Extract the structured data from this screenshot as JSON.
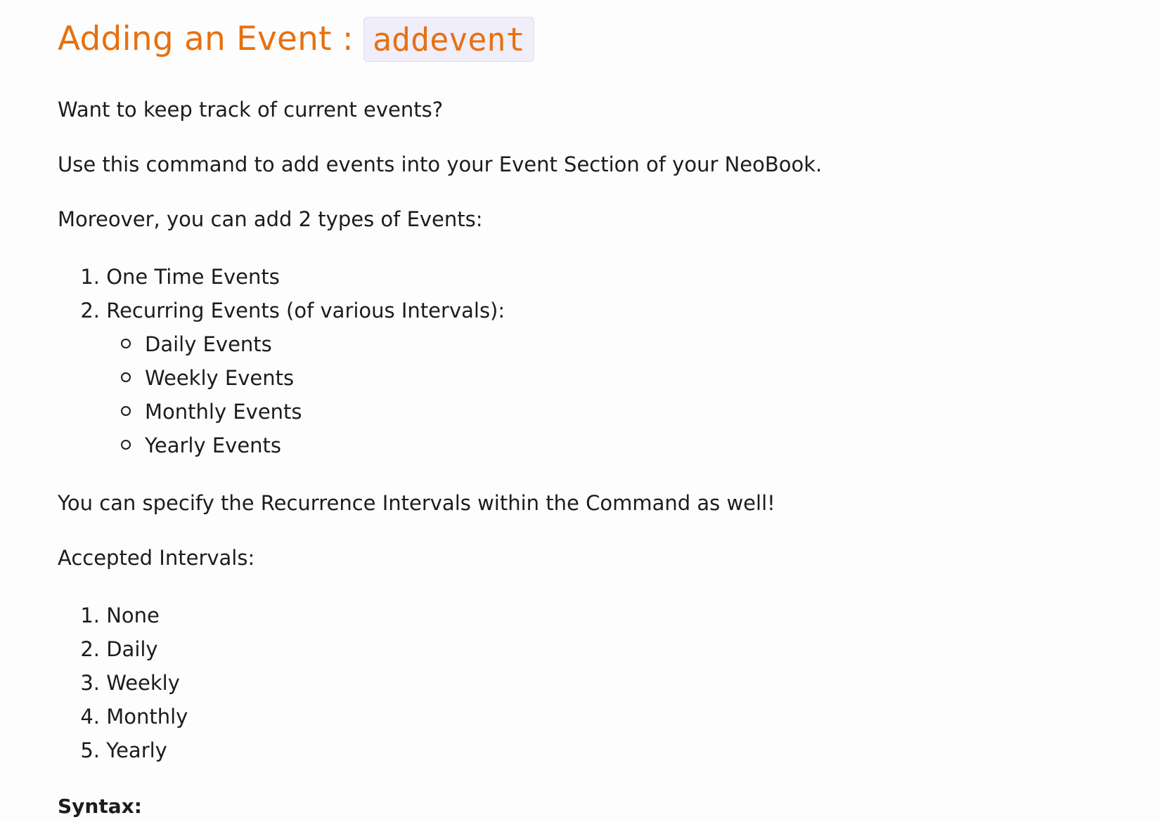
{
  "heading": {
    "title": "Adding an Event :",
    "command": "addevent"
  },
  "intro": {
    "line1": "Want to keep track of current events?",
    "line2": "Use this command to add events into your Event Section of your NeoBook.",
    "line3": "Moreover, you can add 2 types of Events:"
  },
  "event_types": [
    {
      "number": "1.",
      "label": "One Time Events"
    },
    {
      "number": "2.",
      "label": "Recurring Events (of various Intervals):"
    }
  ],
  "recurring_types": [
    "Daily Events",
    "Weekly Events",
    "Monthly Events",
    "Yearly Events"
  ],
  "recurrence_note": "You can specify the Recurrence Intervals within the Command as well!",
  "intervals_heading": "Accepted Intervals:",
  "intervals": [
    {
      "number": "1.",
      "label": "None"
    },
    {
      "number": "2.",
      "label": "Daily"
    },
    {
      "number": "3.",
      "label": "Weekly"
    },
    {
      "number": "4.",
      "label": "Monthly"
    },
    {
      "number": "5.",
      "label": "Yearly"
    }
  ],
  "syntax_label": "Syntax:",
  "colors": {
    "heading": "#e8700f",
    "code_background": "#efeefa",
    "text": "#1c1c1c"
  }
}
